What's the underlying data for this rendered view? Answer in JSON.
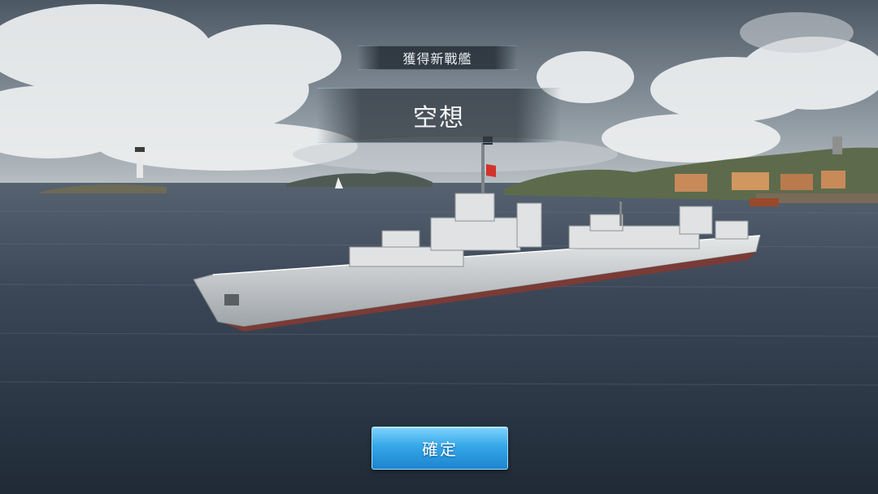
{
  "header": {
    "title": "獲得新戰艦"
  },
  "ship": {
    "name": "空想"
  },
  "actions": {
    "confirm_label": "確定"
  },
  "colors": {
    "sea": "#3a4654",
    "sky": "#5d6a78",
    "button": "#2a9be0",
    "hull": "#d8dadb"
  }
}
